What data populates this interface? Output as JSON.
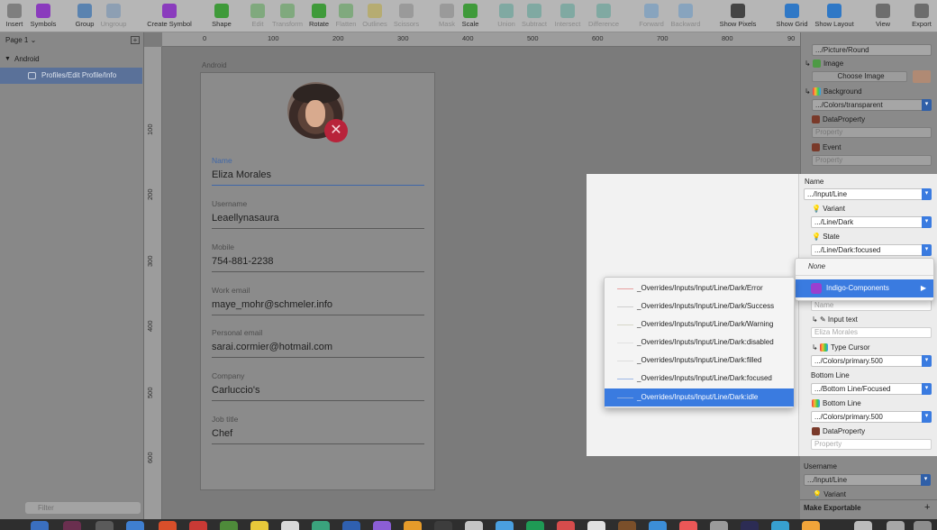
{
  "toolbar": {
    "items": [
      {
        "label": "Insert",
        "icon": "plus-icon",
        "enabled": true
      },
      {
        "label": "Symbols",
        "icon": "symbols-icon",
        "enabled": true
      },
      {
        "label": "Group",
        "icon": "group-icon",
        "enabled": true
      },
      {
        "label": "Ungroup",
        "icon": "ungroup-icon",
        "enabled": false
      },
      {
        "label": "Create Symbol",
        "icon": "create-symbol-icon",
        "enabled": true
      },
      {
        "label": "Shape",
        "icon": "shape-icon",
        "enabled": true
      },
      {
        "label": "Edit",
        "icon": "edit-icon",
        "enabled": false
      },
      {
        "label": "Transform",
        "icon": "transform-icon",
        "enabled": false
      },
      {
        "label": "Rotate",
        "icon": "rotate-icon",
        "enabled": true
      },
      {
        "label": "Flatten",
        "icon": "flatten-icon",
        "enabled": false
      },
      {
        "label": "Outlines",
        "icon": "outlines-icon",
        "enabled": false
      },
      {
        "label": "Scissors",
        "icon": "scissors-icon",
        "enabled": false
      },
      {
        "label": "Mask",
        "icon": "mask-icon",
        "enabled": false
      },
      {
        "label": "Scale",
        "icon": "scale-icon",
        "enabled": true
      },
      {
        "label": "Union",
        "icon": "union-icon",
        "enabled": false
      },
      {
        "label": "Subtract",
        "icon": "subtract-icon",
        "enabled": false
      },
      {
        "label": "Intersect",
        "icon": "intersect-icon",
        "enabled": false
      },
      {
        "label": "Difference",
        "icon": "difference-icon",
        "enabled": false
      },
      {
        "label": "Forward",
        "icon": "forward-icon",
        "enabled": false
      },
      {
        "label": "Backward",
        "icon": "backward-icon",
        "enabled": false
      },
      {
        "label": "Show Pixels",
        "icon": "show-pixels-icon",
        "enabled": true
      },
      {
        "label": "Show Grid",
        "icon": "show-grid-icon",
        "enabled": true
      },
      {
        "label": "Show Layout",
        "icon": "show-layout-icon",
        "enabled": true
      },
      {
        "label": "View",
        "icon": "view-icon",
        "enabled": true
      },
      {
        "label": "Export",
        "icon": "export-icon",
        "enabled": true
      }
    ]
  },
  "left_panel": {
    "page_select": "Page 1",
    "tree": {
      "group": "Android",
      "item": "Profiles/Edit Profile/Info"
    },
    "filter_placeholder": "Filter"
  },
  "canvas": {
    "ruler_h": [
      "0",
      "100",
      "200",
      "300",
      "400",
      "500",
      "600",
      "700",
      "800",
      "90"
    ],
    "ruler_v": [
      "100",
      "200",
      "300",
      "400",
      "500",
      "600"
    ],
    "artboard_label": "Android",
    "form": {
      "fields": [
        {
          "label": "Name",
          "value": "Eliza Morales",
          "focused": true
        },
        {
          "label": "Username",
          "value": "Leaellynasaura"
        },
        {
          "label": "Mobile",
          "value": "754-881-2238"
        },
        {
          "label": "Work email",
          "value": "maye_mohr@schmeler.info"
        },
        {
          "label": "Personal email",
          "value": "sarai.cormier@hotmail.com"
        },
        {
          "label": "Company",
          "value": "Carluccio's"
        },
        {
          "label": "Job title",
          "value": "Chef"
        }
      ],
      "remove_glyph": "✕"
    }
  },
  "right_panel": {
    "top": {
      "picture_select": ".../Picture/Round",
      "image_label": "Image",
      "choose_image": "Choose Image",
      "background_label": "Background",
      "background_value": ".../Colors/transparent",
      "dataproperty_label": "DataProperty",
      "property_placeholder": "Property",
      "event_label": "Event",
      "event_placeholder": "Property"
    },
    "bottom": {
      "username_label": "Username",
      "username_value": ".../Input/Line",
      "variant_label": "Variant",
      "make_exportable": "Make Exportable",
      "plus": "+"
    }
  },
  "overlay": {
    "name_label": "Name",
    "name_value": ".../Input/Line",
    "variant_label": "Variant",
    "variant_value": ".../Line/Dark",
    "state_label": "State",
    "state_value": ".../Line/Dark:focused",
    "name_input_placeholder": "Name",
    "input_text_label": "Input text",
    "input_text_placeholder": "Eliza Morales",
    "type_cursor_label": "Type Cursor",
    "type_cursor_value": ".../Colors/primary.500",
    "bottom_line_label": "Bottom Line",
    "bottom_line_value": ".../Bottom Line/Focused",
    "bottom_line2_label": "Bottom Line",
    "bottom_line2_value": ".../Colors/primary.500",
    "dataproperty_label": "DataProperty",
    "property_placeholder": "Property"
  },
  "menu_libraries": {
    "none": "None",
    "selected": "Indigo-Components",
    "caret": "▶"
  },
  "menu_overrides": {
    "items": [
      {
        "label": "_Overrides/Inputs/Input/Line/Dark/Error",
        "swatch": "#e8a0a0",
        "selected": false
      },
      {
        "label": "_Overrides/Inputs/Input/Line/Dark/Success",
        "swatch": "#cfcfcf",
        "selected": false
      },
      {
        "label": "_Overrides/Inputs/Input/Line/Dark/Warning",
        "swatch": "#d6d6c8",
        "selected": false
      },
      {
        "label": "_Overrides/Inputs/Input/Line/Dark:disabled",
        "swatch": "#e1e1e1",
        "selected": false
      },
      {
        "label": "_Overrides/Inputs/Input/Line/Dark:filled",
        "swatch": "#dedede",
        "selected": false
      },
      {
        "label": "_Overrides/Inputs/Input/Line/Dark:focused",
        "swatch": "#9db8e6",
        "selected": false
      },
      {
        "label": "_Overrides/Inputs/Input/Line/Dark:idle",
        "swatch": "#8aa9de",
        "selected": true
      }
    ]
  },
  "colors": {
    "accent": "#3a7be0",
    "remove": "#b8233a",
    "focus": "#3f67a8"
  }
}
